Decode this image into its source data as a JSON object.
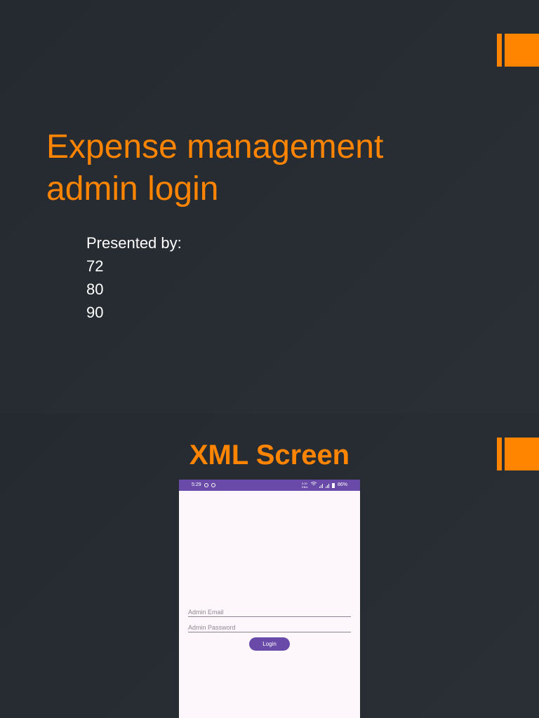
{
  "slide1": {
    "title_line1": "Expense management",
    "title_line2": "admin login",
    "presenter_label": "Presented by:",
    "presenters": [
      "72",
      "80",
      "90"
    ]
  },
  "slide2": {
    "title": "XML Screen",
    "phone": {
      "status_bar": {
        "time": "5:29",
        "network_label": "0.00 KB/s",
        "battery_percent": "86%",
        "color": "#6a4aa8"
      },
      "email_placeholder": "Admin Email",
      "password_placeholder": "Admin Password",
      "login_label": "Login",
      "background": "#fdf7fc"
    }
  },
  "colors": {
    "accent": "#ff8400",
    "background": "#262b31",
    "text": "#ffffff"
  }
}
